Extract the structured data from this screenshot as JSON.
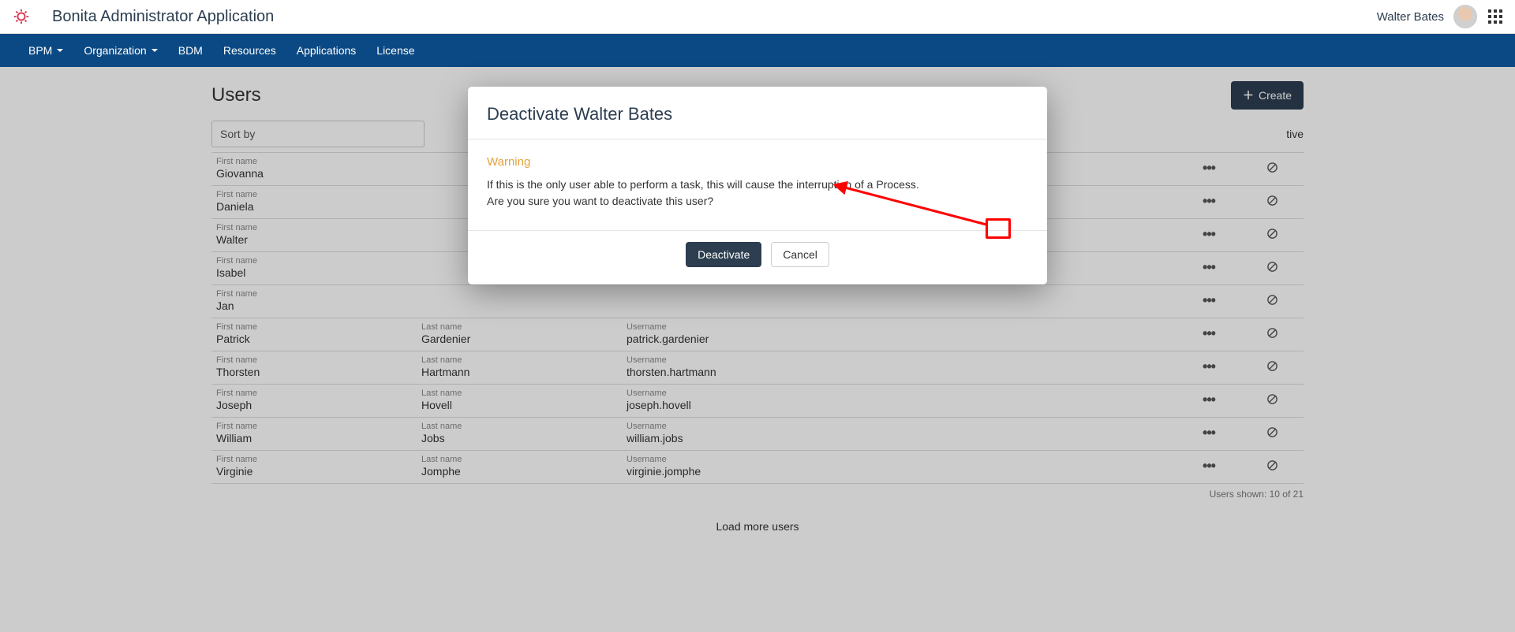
{
  "header": {
    "app_title": "Bonita Administrator Application",
    "username": "Walter Bates"
  },
  "nav": {
    "items": [
      "BPM",
      "Organization",
      "BDM",
      "Resources",
      "Applications",
      "License"
    ],
    "dropdown_flags": [
      true,
      true,
      false,
      false,
      false,
      false
    ]
  },
  "page": {
    "title": "Users",
    "create_label": "Create",
    "sort_placeholder": "Sort by",
    "inactive_tab": "tive",
    "footer_note": "Users shown: 10 of 21",
    "load_more": "Load more users"
  },
  "labels": {
    "first_name": "First name",
    "last_name": "Last name",
    "username": "Username"
  },
  "users": [
    {
      "first": "Giovanna",
      "last": "",
      "user": ""
    },
    {
      "first": "Daniela",
      "last": "",
      "user": ""
    },
    {
      "first": "Walter",
      "last": "",
      "user": ""
    },
    {
      "first": "Isabel",
      "last": "",
      "user": ""
    },
    {
      "first": "Jan",
      "last": "",
      "user": ""
    },
    {
      "first": "Patrick",
      "last": "Gardenier",
      "user": "patrick.gardenier"
    },
    {
      "first": "Thorsten",
      "last": "Hartmann",
      "user": "thorsten.hartmann"
    },
    {
      "first": "Joseph",
      "last": "Hovell",
      "user": "joseph.hovell"
    },
    {
      "first": "William",
      "last": "Jobs",
      "user": "william.jobs"
    },
    {
      "first": "Virginie",
      "last": "Jomphe",
      "user": "virginie.jomphe"
    }
  ],
  "modal": {
    "title": "Deactivate Walter Bates",
    "warning_label": "Warning",
    "line1": "If this is the only user able to perform a task, this will cause the interruption of a Process.",
    "line2": "Are you sure you want to deactivate this user?",
    "confirm": "Deactivate",
    "cancel": "Cancel"
  }
}
